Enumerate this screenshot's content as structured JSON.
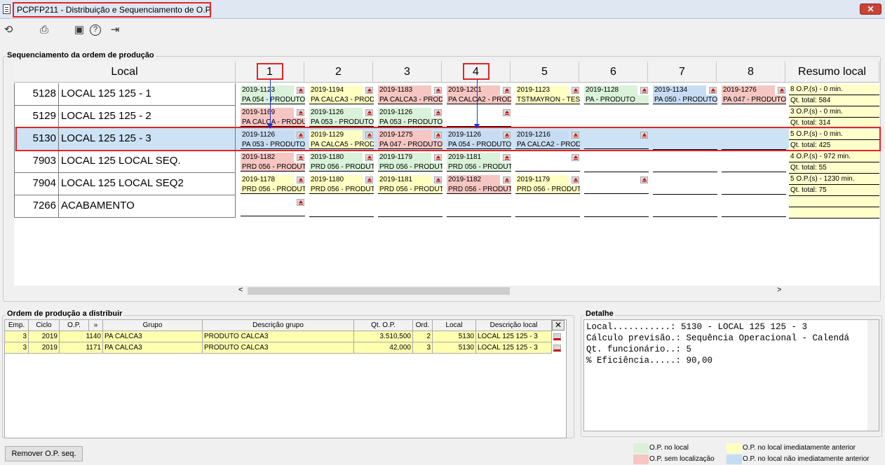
{
  "window": {
    "title": "PCPFP211 - Distribuição e Sequenciamento de O.P.",
    "close_label": "✕"
  },
  "toolbar": {
    "icons": [
      "refresh-icon",
      "print-icon",
      "calendar-icon",
      "help-icon",
      "exit-icon"
    ],
    "glyphs": [
      "⟲",
      "⎙",
      "▣",
      "?",
      "⇥"
    ]
  },
  "seq_panel": {
    "title": "Sequenciamento da ordem de produção",
    "headers": {
      "local": "Local",
      "cols": [
        "1",
        "2",
        "3",
        "4",
        "5",
        "6",
        "7",
        "8"
      ],
      "resumo": "Resumo local"
    },
    "rows": [
      {
        "code": "5128",
        "name": "LOCAL 125 125 - 1",
        "cells": [
          {
            "op": "2019-1123",
            "desc": "PA 054 - PRODUTO",
            "color": "green"
          },
          {
            "op": "2019-1194",
            "desc": "PA CALCA3 - PRODUTO",
            "color": "yellow"
          },
          {
            "op": "2019-1183",
            "desc": "PA CALCA3 - PRODUTO",
            "color": "red"
          },
          {
            "op": "2019-1201",
            "desc": "PA CALCA2 - PRODUTO",
            "color": "red"
          },
          {
            "op": "2019-1123",
            "desc": "TSTMAYRON - TESTE",
            "color": "yellow"
          },
          {
            "op": "2019-1128",
            "desc": "PA - PRODUTO",
            "color": "green"
          },
          {
            "op": "2019-1134",
            "desc": "PA 050 - PRODUTO",
            "color": "blue"
          },
          {
            "op": "2019-1276",
            "desc": "PA 047 - PRODUTO",
            "color": "red"
          }
        ],
        "resumo": [
          "8 O.P.(s) - 0 min.",
          "Qt. total: 584"
        ]
      },
      {
        "code": "5129",
        "name": "LOCAL 125 125 - 2",
        "cells": [
          {
            "op": "2019-1169",
            "desc": "PA CALCA - PRODUTO",
            "color": "red"
          },
          {
            "op": "2019-1126",
            "desc": "PA 053 - PRODUTO",
            "color": "green"
          },
          {
            "op": "2019-1126",
            "desc": "PA 053 - PRODUTO",
            "color": "green"
          },
          {
            "op": "",
            "desc": "",
            "color": ""
          }
        ],
        "resumo": [
          "3 O.P.(s) - 0 min.",
          "Qt. total: 314"
        ]
      },
      {
        "code": "5130",
        "name": "LOCAL 125 125 - 3",
        "cells": [
          {
            "op": "2019-1126",
            "desc": "PA 053 - PRODUTO",
            "color": "blue"
          },
          {
            "op": "2019-1129",
            "desc": "PA CALCA5 - PRODUTO",
            "color": "yellow"
          },
          {
            "op": "2019-1275",
            "desc": "PA 047 - PRODUTO",
            "color": "red"
          },
          {
            "op": "2019-1126",
            "desc": "PA 054 - PRODUTO",
            "color": "blue"
          },
          {
            "op": "2019-1216",
            "desc": "PA CALCA2 - PRODUTO",
            "color": "blue"
          },
          {
            "op": "",
            "desc": "",
            "color": ""
          }
        ],
        "resumo": [
          "5 O.P.(s) - 0 min.",
          "Qt. total: 425"
        ]
      },
      {
        "code": "7903",
        "name": "LOCAL 125 LOCAL SEQ.",
        "cells": [
          {
            "op": "2019-1182",
            "desc": "PRD 056 - PRODUTO",
            "color": "red"
          },
          {
            "op": "2019-1180",
            "desc": "PRD 056 - PRODUTO",
            "color": "green"
          },
          {
            "op": "2019-1179",
            "desc": "PRD 056 - PRODUTO",
            "color": "green"
          },
          {
            "op": "2019-1181",
            "desc": "PRD 056 - PRODUTO",
            "color": "green"
          },
          {
            "op": "",
            "desc": "",
            "color": ""
          }
        ],
        "resumo": [
          "4 O.P.(s) - 972 min.",
          "Qt. total: 55"
        ]
      },
      {
        "code": "7904",
        "name": "LOCAL 125 LOCAL SEQ2",
        "cells": [
          {
            "op": "2019-1178",
            "desc": "PRD 056 - PRODUTO",
            "color": "yellow"
          },
          {
            "op": "2019-1180",
            "desc": "PRD 056 - PRODUTO",
            "color": "yellow"
          },
          {
            "op": "2019-1181",
            "desc": "PRD 056 - PRODUTO",
            "color": "yellow"
          },
          {
            "op": "2019-1182",
            "desc": "PRD 056 - PRODUTO",
            "color": "red"
          },
          {
            "op": "2019-1179",
            "desc": "PRD 056 - PRODUTO",
            "color": "yellow"
          },
          {
            "op": "",
            "desc": "",
            "color": ""
          }
        ],
        "resumo": [
          "5 O.P.(s) - 1230 min.",
          "Qt. total: 75"
        ]
      },
      {
        "code": "7266",
        "name": "ACABAMENTO",
        "cells": [
          {
            "op": "",
            "desc": "",
            "color": ""
          }
        ],
        "resumo": [
          "",
          ""
        ]
      }
    ],
    "scroll_left": "<",
    "scroll_right": ">"
  },
  "op_panel": {
    "title": "Ordem de produção a distribuir",
    "headers": [
      "Emp.",
      "Ciclo",
      "O.P.",
      "»",
      "Grupo",
      "Descrição grupo",
      "Qt. O.P.",
      "Ord.",
      "Local",
      "Descrição local"
    ],
    "rows": [
      [
        "3",
        "2019",
        "1140",
        "PA CALCA3",
        "PRODUTO CALCA3",
        "3.510,500",
        "2",
        "5130",
        "LOCAL 125 125 - 3"
      ],
      [
        "3",
        "2019",
        "1171",
        "PA CALCA3",
        "PRODUTO CALCA3",
        "42,000",
        "3",
        "5130",
        "LOCAL 125 125 - 3"
      ]
    ]
  },
  "detail_panel": {
    "title": "Detalhe",
    "lines": [
      "Local...........: 5130 - LOCAL 125 125 - 3",
      "Cálculo previsão.: Sequência Operacional - Calendá",
      "Qt. funcionário..: 5",
      "% Eficiência.....: 90,00"
    ]
  },
  "remove_button": "Remover O.P. seq.",
  "legend": [
    {
      "label": "O.P. no local",
      "color": "#d9f2d9"
    },
    {
      "label": "O.P. no local imediatamente anterior",
      "color": "#ffffc2"
    },
    {
      "label": "O.P. sem localização",
      "color": "#f6c6c2"
    },
    {
      "label": "O.P. no local não imediatamente anterior",
      "color": "#c7dcf2"
    }
  ],
  "colors": {
    "highlight_outline": "#e0262b",
    "arrow": "#2030e0",
    "selected_row": "#cde3f5"
  }
}
